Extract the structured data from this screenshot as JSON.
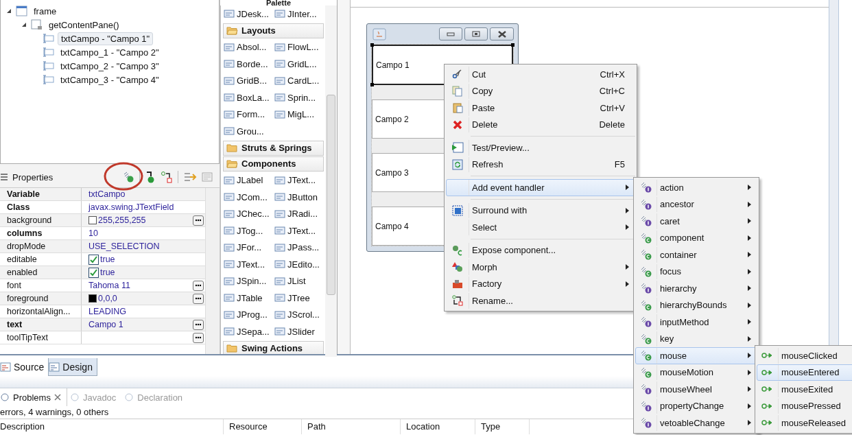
{
  "tree": [
    {
      "label": "frame",
      "expanded": true,
      "children": [
        {
          "label": "getContentPane()",
          "expanded": true,
          "children": [
            {
              "label": "txtCampo - \"Campo 1\"",
              "selected": true
            },
            {
              "label": "txtCampo_1 - \"Campo 2\"",
              "selected": false
            },
            {
              "label": "txtCampo_2 - \"Campo 3\"",
              "selected": false
            },
            {
              "label": "txtCampo_3 - \"Campo 4\"",
              "selected": false
            }
          ]
        }
      ]
    }
  ],
  "properties": {
    "title": "Properties",
    "rows": [
      {
        "name": "Variable",
        "value": "txtCampo",
        "modified": true,
        "kind": "text",
        "editor": false
      },
      {
        "name": "Class",
        "value": "javax.swing.JTextField",
        "modified": true,
        "kind": "text",
        "editor": false
      },
      {
        "name": "background",
        "value": "255,255,255",
        "modified": false,
        "kind": "color",
        "color": "#ffffff",
        "editor": true
      },
      {
        "name": "columns",
        "value": "10",
        "modified": true,
        "kind": "text",
        "editor": false
      },
      {
        "name": "dropMode",
        "value": "USE_SELECTION",
        "modified": false,
        "kind": "text",
        "editor": false
      },
      {
        "name": "editable",
        "value": "true",
        "modified": false,
        "kind": "boolean",
        "checked": true,
        "editor": false
      },
      {
        "name": "enabled",
        "value": "true",
        "modified": false,
        "kind": "boolean",
        "checked": true,
        "editor": false
      },
      {
        "name": "font",
        "value": "Tahoma 11",
        "modified": false,
        "kind": "text",
        "editor": true
      },
      {
        "name": "foreground",
        "value": "0,0,0",
        "modified": false,
        "kind": "color",
        "color": "#000000",
        "editor": true
      },
      {
        "name": "horizontalAlign...",
        "value": "LEADING",
        "modified": false,
        "kind": "text",
        "editor": false
      },
      {
        "name": "text",
        "value": "Campo 1",
        "modified": true,
        "kind": "text",
        "editor": true
      },
      {
        "name": "toolTipText",
        "modified": false,
        "kind": "text",
        "editor": true
      }
    ]
  },
  "palette": {
    "title": "Palette",
    "entries": [
      {
        "kind": "row",
        "items": [
          "JDesk...",
          "JInter..."
        ]
      },
      {
        "kind": "category",
        "label": "Layouts",
        "expanded": true
      },
      {
        "kind": "row",
        "items": [
          "Absol...",
          "FlowL..."
        ]
      },
      {
        "kind": "row",
        "items": [
          "Borde...",
          "GridL..."
        ]
      },
      {
        "kind": "row",
        "items": [
          "GridB...",
          "CardL..."
        ]
      },
      {
        "kind": "row",
        "items": [
          "BoxLa...",
          "Sprin..."
        ]
      },
      {
        "kind": "row",
        "items": [
          "Form...",
          "MigL..."
        ]
      },
      {
        "kind": "row",
        "items": [
          "Grou..."
        ]
      },
      {
        "kind": "category",
        "label": "Struts & Springs",
        "expanded": false
      },
      {
        "kind": "category",
        "label": "Components",
        "expanded": true
      },
      {
        "kind": "row",
        "items": [
          "JLabel",
          "JText..."
        ]
      },
      {
        "kind": "row",
        "items": [
          "JCom...",
          "JButton"
        ]
      },
      {
        "kind": "row",
        "items": [
          "JChec...",
          "JRadi..."
        ]
      },
      {
        "kind": "row",
        "items": [
          "JTog...",
          "JText..."
        ]
      },
      {
        "kind": "row",
        "items": [
          "JFor...",
          "JPass..."
        ]
      },
      {
        "kind": "row",
        "items": [
          "JText...",
          "JEdito..."
        ]
      },
      {
        "kind": "row",
        "items": [
          "JSpin...",
          "JList"
        ]
      },
      {
        "kind": "row",
        "items": [
          "JTable",
          "JTree"
        ]
      },
      {
        "kind": "row",
        "items": [
          "JProg...",
          "JScrol..."
        ]
      },
      {
        "kind": "row",
        "items": [
          "JSepa...",
          "JSlider"
        ]
      },
      {
        "kind": "category",
        "label": "Swing Actions",
        "expanded": false
      }
    ]
  },
  "form": {
    "fields": [
      {
        "value": "Campo 1",
        "selected": true
      },
      {
        "value": "Campo 2",
        "selected": false
      },
      {
        "value": "Campo 3",
        "selected": false
      },
      {
        "value": "Campo 4",
        "selected": false
      }
    ]
  },
  "context_menu": {
    "items": [
      {
        "label": "Cut",
        "shortcut": "Ctrl+X",
        "submenu": false,
        "selected": false,
        "separator_before": false
      },
      {
        "label": "Copy",
        "shortcut": "Ctrl+C",
        "submenu": false,
        "selected": false,
        "separator_before": false
      },
      {
        "label": "Paste",
        "shortcut": "Ctrl+V",
        "submenu": false,
        "selected": false,
        "separator_before": false
      },
      {
        "label": "Delete",
        "shortcut": "Delete",
        "submenu": false,
        "selected": false,
        "separator_before": false
      },
      {
        "label": "Test/Preview...",
        "submenu": false,
        "selected": false,
        "separator_before": true
      },
      {
        "label": "Refresh",
        "shortcut": "F5",
        "submenu": false,
        "selected": false,
        "separator_before": false
      },
      {
        "label": "Add event handler",
        "submenu": true,
        "selected": true,
        "separator_before": true
      },
      {
        "label": "Surround with",
        "submenu": true,
        "selected": false,
        "separator_before": true
      },
      {
        "label": "Select",
        "submenu": true,
        "selected": false,
        "separator_before": false
      },
      {
        "label": "Expose component...",
        "submenu": false,
        "selected": false,
        "separator_before": true
      },
      {
        "label": "Morph",
        "submenu": true,
        "selected": false,
        "separator_before": false
      },
      {
        "label": "Factory",
        "submenu": true,
        "selected": false,
        "separator_before": false
      },
      {
        "label": "Rename...",
        "submenu": false,
        "selected": false,
        "separator_before": false
      }
    ]
  },
  "event_menu": {
    "items": [
      {
        "label": "action",
        "kind": "interface",
        "selected": false
      },
      {
        "label": "ancestor",
        "kind": "interface",
        "selected": false
      },
      {
        "label": "caret",
        "kind": "interface",
        "selected": false
      },
      {
        "label": "component",
        "kind": "class",
        "selected": false
      },
      {
        "label": "container",
        "kind": "class",
        "selected": false
      },
      {
        "label": "focus",
        "kind": "class",
        "selected": false
      },
      {
        "label": "hierarchy",
        "kind": "interface",
        "selected": false
      },
      {
        "label": "hierarchyBounds",
        "kind": "class",
        "selected": false
      },
      {
        "label": "inputMethod",
        "kind": "interface",
        "selected": false
      },
      {
        "label": "key",
        "kind": "class",
        "selected": false
      },
      {
        "label": "mouse",
        "kind": "class",
        "selected": true
      },
      {
        "label": "mouseMotion",
        "kind": "class",
        "selected": false
      },
      {
        "label": "mouseWheel",
        "kind": "interface",
        "selected": false
      },
      {
        "label": "propertyChange",
        "kind": "interface",
        "selected": false
      },
      {
        "label": "vetoableChange",
        "kind": "interface",
        "selected": false
      }
    ]
  },
  "mouse_menu": {
    "items": [
      {
        "label": "mouseClicked",
        "selected": false
      },
      {
        "label": "mouseEntered",
        "selected": true
      },
      {
        "label": "mouseExited",
        "selected": false
      },
      {
        "label": "mousePressed",
        "selected": false
      },
      {
        "label": "mouseReleased",
        "selected": false
      }
    ]
  },
  "editor_tabs": [
    {
      "label": "Source",
      "selected": false
    },
    {
      "label": "Design",
      "selected": true
    }
  ],
  "views": {
    "tabs": [
      {
        "label": "Problems",
        "selected": true
      },
      {
        "label": "Javadoc",
        "selected": false
      },
      {
        "label": "Declaration",
        "selected": false
      }
    ],
    "summary": "errors, 4 warnings, 0 others",
    "columns": [
      "Description",
      "Resource",
      "Path",
      "Location",
      "Type"
    ]
  }
}
